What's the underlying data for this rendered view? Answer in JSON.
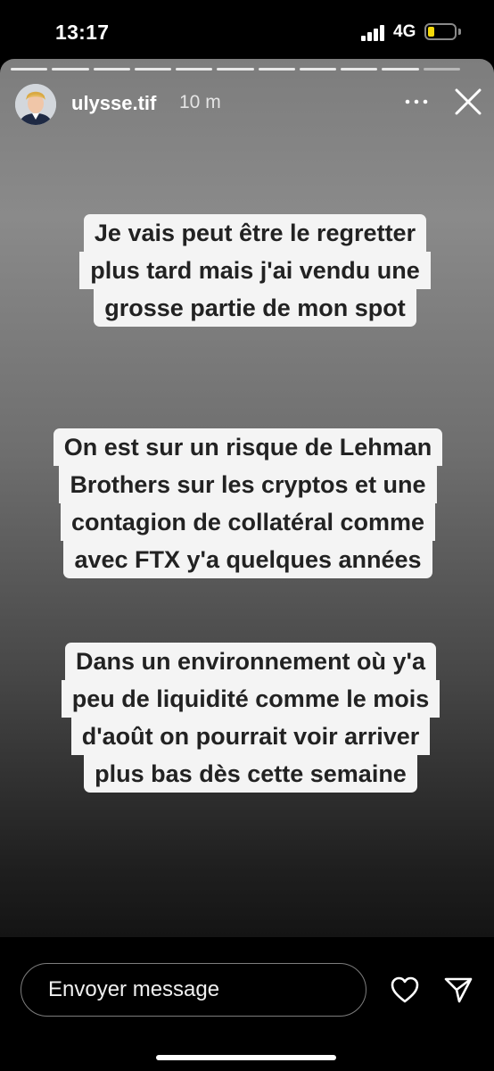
{
  "status_bar": {
    "time": "13:17",
    "network": "4G",
    "battery_level": 0.25,
    "battery_color": "#f5d90a"
  },
  "story": {
    "username": "ulysse.tif",
    "time_ago": "10 m",
    "progress_segments": 11,
    "progress_viewed": 10,
    "text_blocks": [
      {
        "lines": [
          "Je vais peut être le regretter",
          "plus tard mais j'ai vendu une",
          "grosse partie de mon spot"
        ]
      },
      {
        "lines": [
          "On est sur un risque de Lehman",
          "Brothers sur les cryptos et une",
          "contagion de collatéral comme",
          "avec FTX y'a quelques années"
        ]
      },
      {
        "lines": [
          "Dans un environnement où y'a",
          "peu de liquidité comme le mois",
          "d'août on pourrait voir arriver",
          "plus bas dès cette semaine"
        ]
      }
    ]
  },
  "bottom_bar": {
    "message_placeholder": "Envoyer message",
    "icons": [
      "heart-icon",
      "send-icon"
    ]
  },
  "icons": {
    "more": "more-icon",
    "close": "close-icon"
  }
}
